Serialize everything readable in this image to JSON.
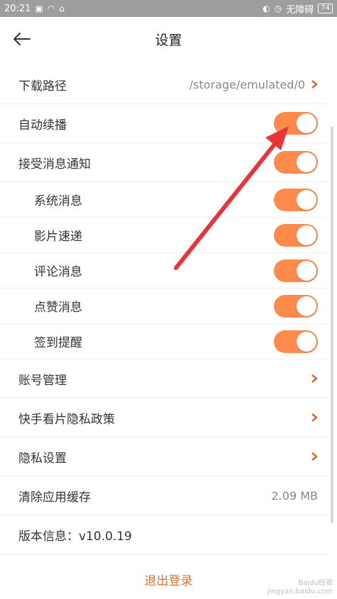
{
  "status": {
    "time": "20:21",
    "carrier": "无障碍",
    "battery": "74"
  },
  "header": {
    "title": "设置"
  },
  "settings": {
    "download_path": {
      "label": "下载路径",
      "value": "/storage/emulated/0"
    },
    "auto_play": {
      "label": "自动续播",
      "on": true
    },
    "notifications": {
      "label": "接受消息通知",
      "on": true
    },
    "system_msg": {
      "label": "系统消息",
      "on": true
    },
    "movie_express": {
      "label": "影片速递",
      "on": true
    },
    "comment_msg": {
      "label": "评论消息",
      "on": true
    },
    "like_msg": {
      "label": "点赞消息",
      "on": true
    },
    "checkin_reminder": {
      "label": "签到提醒",
      "on": true
    },
    "account": {
      "label": "账号管理"
    },
    "privacy_policy": {
      "label": "快手看片隐私政策"
    },
    "privacy_settings": {
      "label": "隐私设置"
    },
    "clear_cache": {
      "label": "清除应用缓存",
      "value": "2.09 MB"
    },
    "version": {
      "label": "版本信息：v10.0.19"
    }
  },
  "logout": {
    "label": "退出登录"
  },
  "watermark": {
    "line1": "Baidu经验",
    "line2": "jingyan.baidu.com"
  },
  "colors": {
    "accent": "#ff8a4c",
    "logout": "#e86c2c",
    "chevron": "#e8622a"
  }
}
